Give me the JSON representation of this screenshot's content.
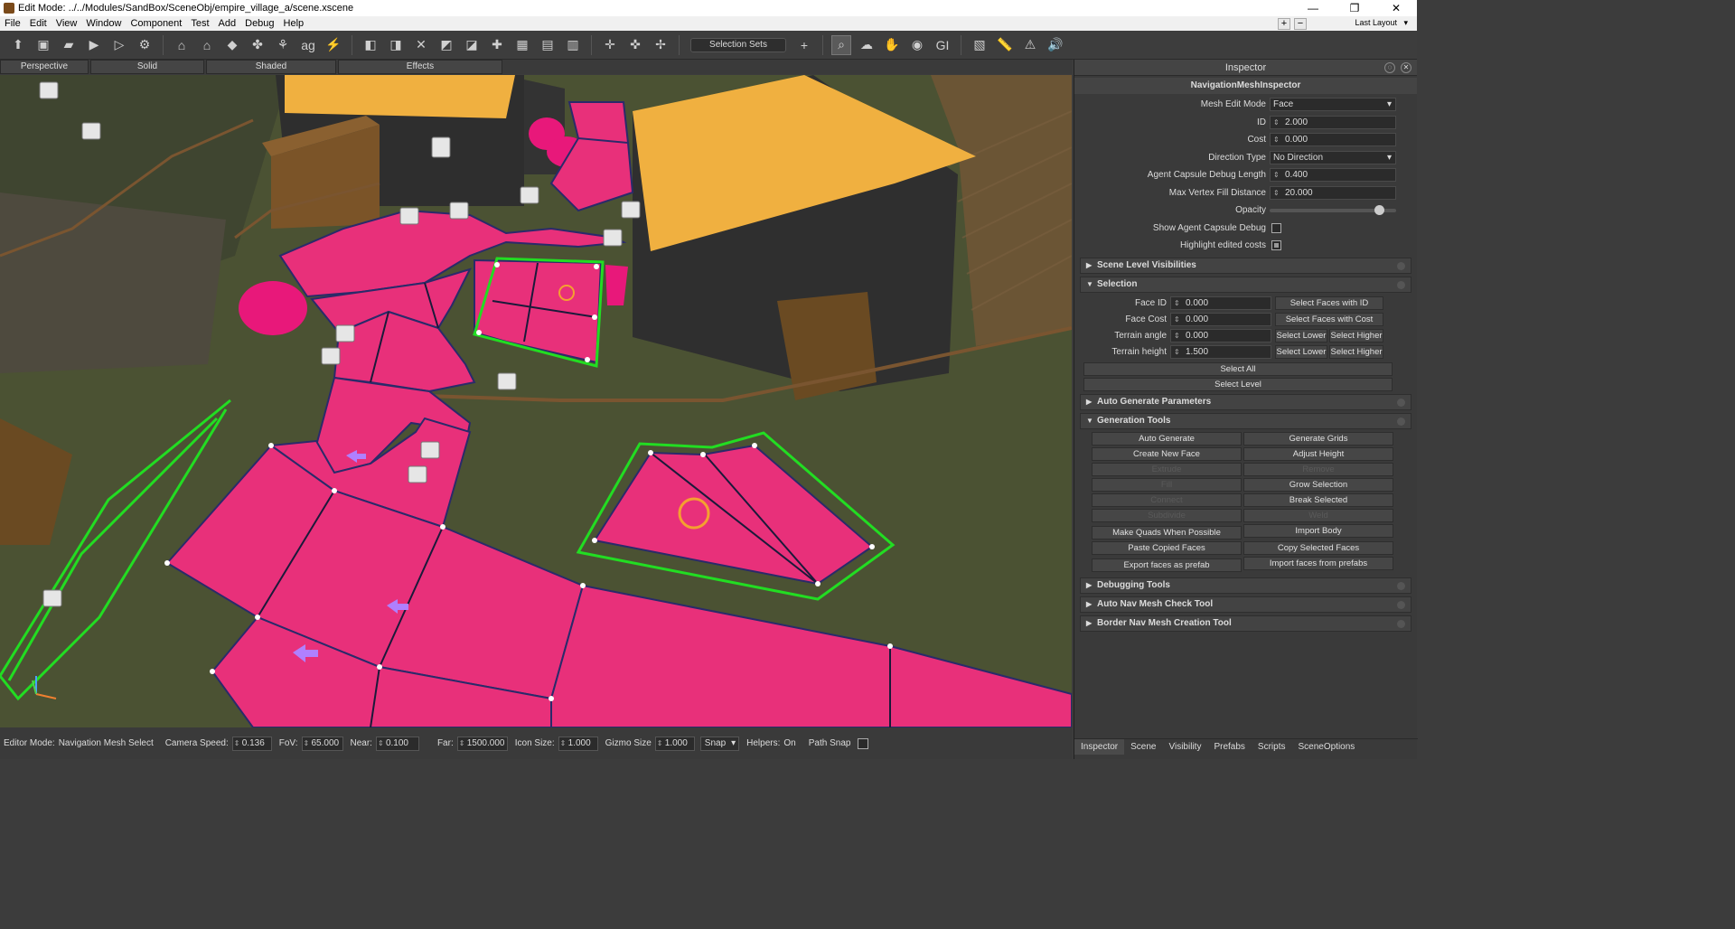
{
  "window": {
    "title": "Edit Mode: ../../Modules/SandBox/SceneObj/empire_village_a/scene.xscene",
    "minimize": "—",
    "restore": "❐",
    "close": "✕"
  },
  "menu": {
    "items": [
      "File",
      "Edit",
      "View",
      "Window",
      "Component",
      "Test",
      "Add",
      "Debug",
      "Help"
    ],
    "plus": "+",
    "minus": "−",
    "layout": "Last Layout"
  },
  "toolbar": {
    "selection_sets": "Selection Sets",
    "add": "+"
  },
  "view_tabs": [
    "Perspective",
    "Solid",
    "Shaded",
    "Effects"
  ],
  "inspector": {
    "title": "Inspector",
    "subtitle": "NavigationMeshInspector",
    "props": [
      {
        "label": "Mesh Edit Mode",
        "value": "Face",
        "kind": "dropdown"
      },
      {
        "label": "ID",
        "value": "2.000",
        "kind": "number"
      },
      {
        "label": "Cost",
        "value": "0.000",
        "kind": "number"
      },
      {
        "label": "Direction Type",
        "value": "No Direction",
        "kind": "dropdown"
      },
      {
        "label": "Agent Capsule Debug Length",
        "value": "0.400",
        "kind": "number"
      },
      {
        "label": "Max Vertex Fill Distance",
        "value": "20.000",
        "kind": "number"
      }
    ],
    "opacity_label": "Opacity",
    "opacity_value": 0.9,
    "show_capsule_label": "Show Agent Capsule Debug",
    "show_capsule_checked": false,
    "highlight_label": "Highlight edited costs",
    "highlight_checked": true,
    "sections": {
      "scene_level": "Scene Level Visibilities",
      "selection": "Selection",
      "auto_gen": "Auto Generate Parameters",
      "gen_tools": "Generation Tools",
      "debugging": "Debugging Tools",
      "auto_check": "Auto Nav Mesh Check Tool",
      "border": "Border Nav Mesh Creation Tool"
    },
    "selection": {
      "face_id_label": "Face ID",
      "face_id": "0.000",
      "select_faces_id": "Select Faces with ID",
      "face_cost_label": "Face Cost",
      "face_cost": "0.000",
      "select_faces_cost": "Select Faces with Cost",
      "terrain_angle_label": "Terrain angle",
      "terrain_angle": "0.000",
      "terrain_height_label": "Terrain height",
      "terrain_height": "1.500",
      "select_lower": "Select Lower",
      "select_higher": "Select Higher",
      "select_all": "Select All",
      "select_level": "Select Level"
    },
    "gen_buttons": [
      {
        "label": "Auto Generate",
        "enabled": true
      },
      {
        "label": "Generate Grids",
        "enabled": true
      },
      {
        "label": "Create New Face",
        "enabled": true
      },
      {
        "label": "Adjust Height",
        "enabled": true
      },
      {
        "label": "Extrude",
        "enabled": false
      },
      {
        "label": "Remove",
        "enabled": false
      },
      {
        "label": "Fill",
        "enabled": false
      },
      {
        "label": "Grow Selection",
        "enabled": true
      },
      {
        "label": "Connect",
        "enabled": false
      },
      {
        "label": "Break Selected",
        "enabled": true
      },
      {
        "label": "Subdivide",
        "enabled": false
      },
      {
        "label": "Weld",
        "enabled": false
      },
      {
        "label": "Make Quads When Possible",
        "enabled": true
      },
      {
        "label": "Import Body",
        "enabled": true
      },
      {
        "label": "Paste Copied Faces",
        "enabled": true
      },
      {
        "label": "Copy Selected Faces",
        "enabled": true
      },
      {
        "label": "Export faces as prefab",
        "enabled": true
      },
      {
        "label": "Import faces from prefabs",
        "enabled": true
      }
    ],
    "bottom_tabs": [
      "Inspector",
      "Scene",
      "Visibility",
      "Prefabs",
      "Scripts",
      "SceneOptions"
    ]
  },
  "status": {
    "editor_mode_label": "Editor Mode:",
    "editor_mode": "Navigation Mesh Select",
    "camera_speed_label": "Camera Speed:",
    "camera_speed": "0.136",
    "fov_label": "FoV:",
    "fov": "65.000",
    "near_label": "Near:",
    "near": "0.100",
    "far_label": "Far:",
    "far": "1500.000",
    "icon_size_label": "Icon Size:",
    "icon_size": "1.000",
    "gizmo_size_label": "Gizmo Size",
    "gizmo_size": "1.000",
    "snap": "Snap",
    "helpers_label": "Helpers:",
    "helpers": "On",
    "path_snap_label": "Path Snap"
  },
  "colors": {
    "navmesh": "#e8307a",
    "selection": "#22dd22",
    "roof": "#f0b040",
    "wall": "#2e2e2e",
    "ground": "#4b5233"
  }
}
